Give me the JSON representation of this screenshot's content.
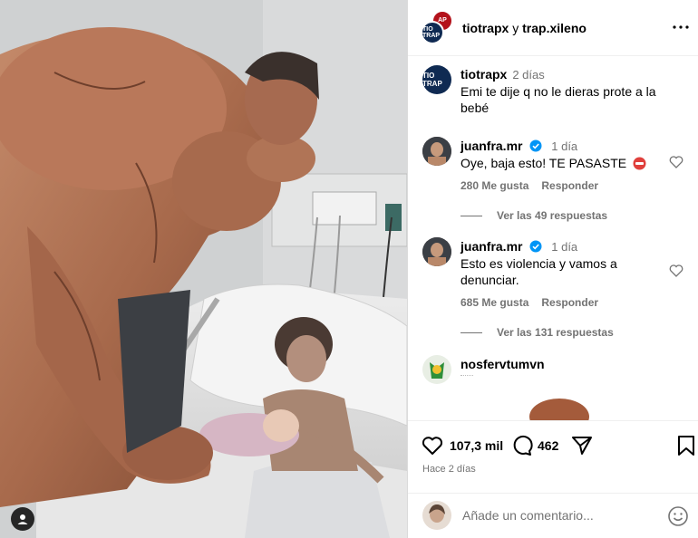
{
  "post": {
    "accounts": [
      "tiotrapx",
      "trap.xileno"
    ],
    "conjunction": "y",
    "avatar_text": "TIO TRAP",
    "avatar_b_text": "AP"
  },
  "caption": {
    "user": "tiotrapx",
    "time": "2 días",
    "text": "Emi te dije q no le dieras prote a la bebé"
  },
  "comments": [
    {
      "user": "juanfra.mr",
      "verified": true,
      "time": "1 día",
      "text": "Oye, baja esto! TE PASASTE",
      "likes": "280 Me gusta",
      "reply": "Responder",
      "view_replies": "Ver las 49 respuestas"
    },
    {
      "user": "juanfra.mr",
      "verified": true,
      "time": "1 día",
      "text": "Esto es violencia y vamos a denunciar.",
      "likes": "685 Me gusta",
      "reply": "Responder",
      "view_replies": "Ver las 131 respuestas"
    },
    {
      "user": "nosfervtumvn",
      "verified": false,
      "time": "",
      "text": ""
    }
  ],
  "actions": {
    "likes_count": "107,3 mil",
    "comments_count": "462",
    "posted": "Hace 2 días"
  },
  "add_comment": {
    "placeholder": "Añade un comentario..."
  },
  "icons": {
    "like": "heart-icon",
    "comment": "comment-icon",
    "share": "send-icon",
    "save": "bookmark-icon",
    "more": "more-options-icon",
    "emoji": "emoji-icon",
    "tag": "user-tag-icon"
  },
  "colors": {
    "secondary_text": "#737373",
    "verified": "#0095f6",
    "divider": "#dbdbdb"
  }
}
